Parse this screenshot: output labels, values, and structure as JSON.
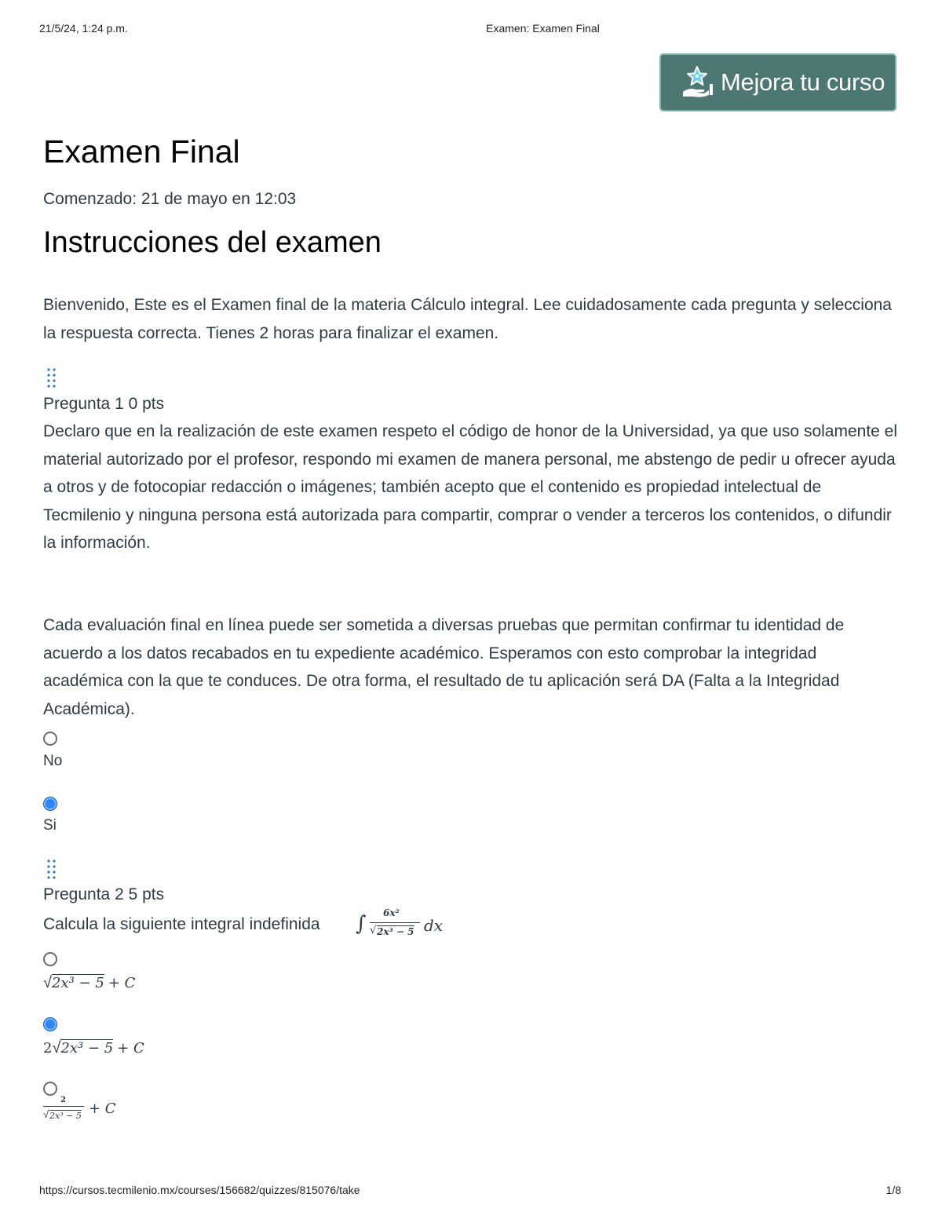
{
  "print_header": {
    "date": "21/5/24, 1:24 p.m.",
    "title": "Examen: Examen Final"
  },
  "promo_button": {
    "label": "Mejora tu curso",
    "icon": "star-hand-icon",
    "color": "#4d7773"
  },
  "exam": {
    "title": "Examen Final",
    "started": "Comenzado: 21 de mayo en 12:03",
    "instructions_heading": "Instrucciones del examen",
    "instructions_text": "Bienvenido, Este es el Examen final de la materia Cálculo integral. Lee cuidadosamente cada pregunta y selecciona la respuesta correcta. Tienes 2 horas para finalizar el examen."
  },
  "questions": [
    {
      "header": "Pregunta 1 0 pts",
      "text_1": "Declaro que en la realización de este examen respeto el código de honor de la Universidad, ya que uso solamente el material autorizado por el profesor, respondo mi examen de manera personal, me abstengo de pedir u ofrecer ayuda a otros y de fotocopiar redacción o imágenes; también acepto que el contenido es propiedad intelectual de Tecmilenio y ninguna persona está autorizada para compartir, comprar o vender a terceros los contenidos, o difundir la información.",
      "text_2": "Cada evaluación final en línea puede ser sometida a diversas pruebas que permitan confirmar tu identidad de acuerdo a los datos recabados en tu expediente académico. Esperamos con esto comprobar la integridad académica con la que te conduces. De otra forma, el resultado de tu aplicación será DA (Falta a la Integridad Académica).",
      "answers": [
        {
          "label": "No",
          "selected": false
        },
        {
          "label": "Si",
          "selected": true
        }
      ]
    },
    {
      "header": "Pregunta 2 5 pts",
      "text": "Calcula la siguiente integral indefinida",
      "integral": {
        "numerator": "6x²",
        "radicand": "2x³ − 5",
        "differential": "dx"
      },
      "answers": [
        {
          "coef": "",
          "radicand": "2x³ − 5",
          "suffix": "+ C",
          "selected": false
        },
        {
          "coef": "2",
          "radicand": "2x³ − 5",
          "suffix": "+ C",
          "selected": true
        },
        {
          "numerator": "2",
          "radicand": "2x³ − 5",
          "suffix": "+ C",
          "selected": false
        }
      ]
    }
  ],
  "print_footer": {
    "url": "https://cursos.tecmilenio.mx/courses/156682/quizzes/815076/take",
    "page": "1/8"
  }
}
